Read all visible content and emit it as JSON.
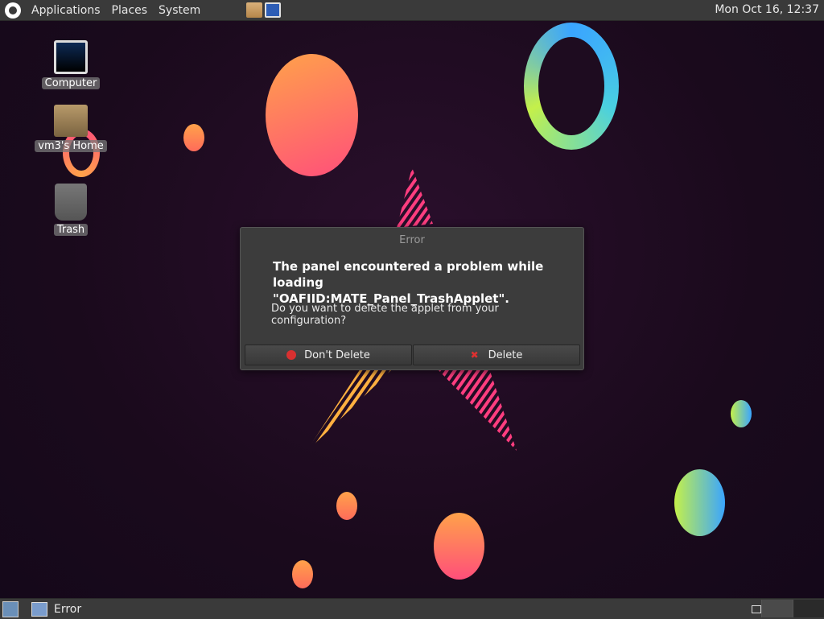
{
  "top_panel": {
    "menus": [
      "Applications",
      "Places",
      "System"
    ],
    "clock": "Mon Oct 16, 12:37"
  },
  "desktop_icons": [
    {
      "label": "Computer",
      "icon": "computer-icon"
    },
    {
      "label": "vm3's Home",
      "icon": "home-folder-icon"
    },
    {
      "label": "Trash",
      "icon": "trash-icon"
    }
  ],
  "dialog": {
    "title": "Error",
    "heading": "The panel encountered a problem while loading \"OAFIID:MATE_Panel_TrashApplet\".",
    "body": "Do you want to delete the applet from your configuration?",
    "buttons": {
      "dont_delete": "Don't Delete",
      "delete": "Delete"
    }
  },
  "bottom_panel": {
    "task": "Error"
  }
}
